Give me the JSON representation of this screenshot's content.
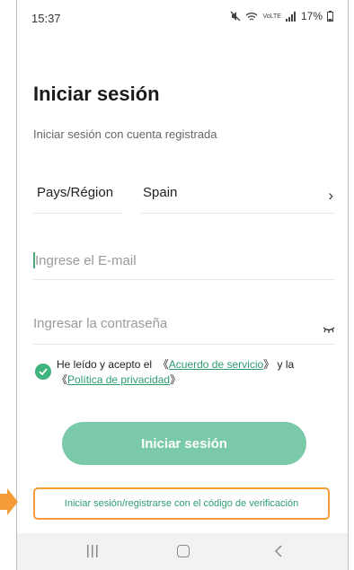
{
  "status_bar": {
    "time": "15:37",
    "network_label": "VoLTE",
    "battery": "17%"
  },
  "login": {
    "title": "Iniciar sesión",
    "subtitle": "Iniciar sesión con cuenta registrada",
    "region_label": "Pays/Région",
    "region_value": "Spain",
    "email_placeholder": "Ingrese el E-mail",
    "password_placeholder": "Ingresar la contraseña",
    "agreement": {
      "prefix": "He leído y acepto el",
      "terms_link": "Acuerdo de servicio",
      "conjunction": "y la",
      "privacy_link": "Política de privacidad"
    },
    "submit_label": "Iniciar sesión",
    "code_login_label": "Iniciar sesión/registrarse con el código de verificación"
  },
  "colors": {
    "accent": "#3fb47f",
    "button": "#7ac9a8",
    "highlight": "#f39c38"
  },
  "icons": [
    "mute-icon",
    "wifi-icon",
    "signal-icon",
    "battery-icon",
    "chevron-right-icon",
    "eye-closed-icon",
    "check-icon",
    "recents-icon",
    "home-icon",
    "back-icon"
  ]
}
